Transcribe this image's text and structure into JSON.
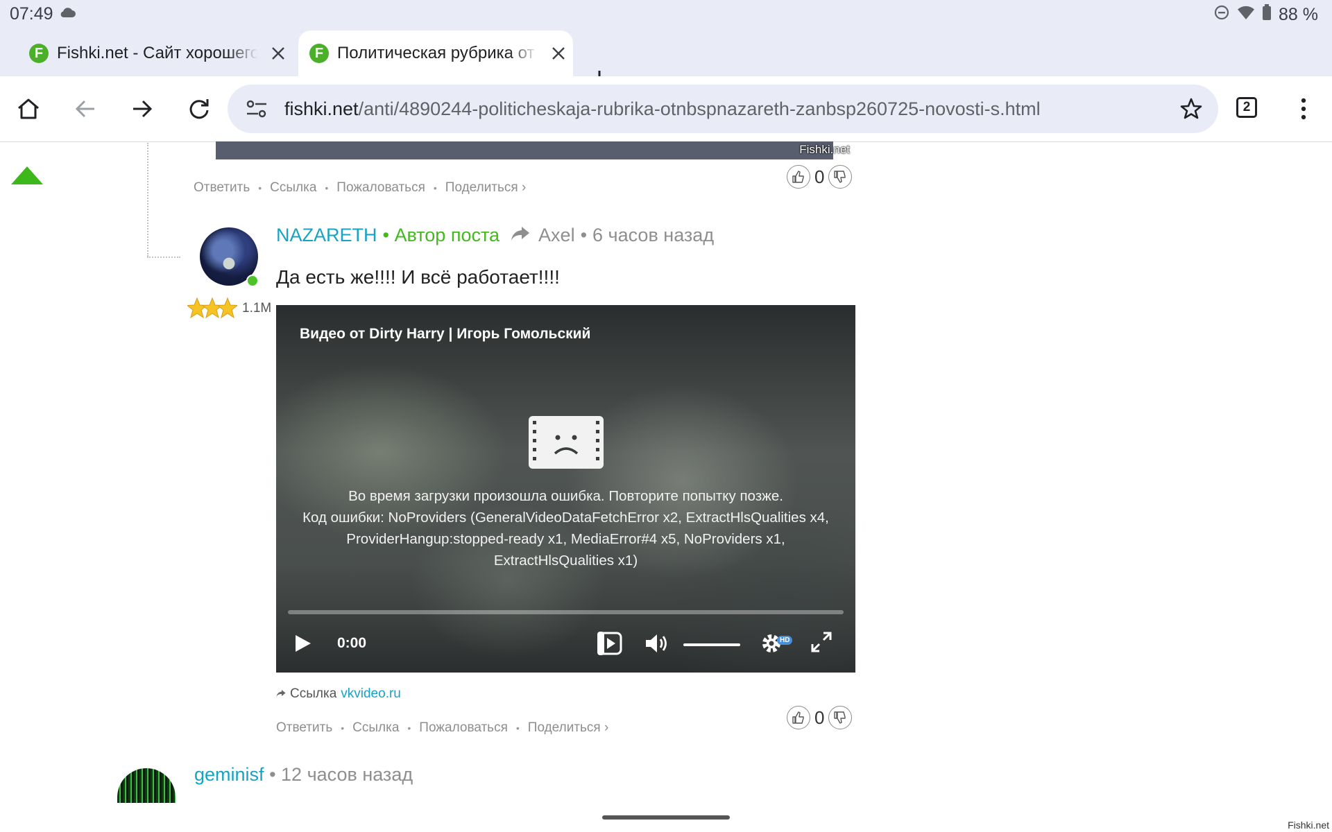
{
  "status_bar": {
    "time": "07:49",
    "battery": "88 %"
  },
  "tabs": [
    {
      "title": "Fishki.net - Сайт хорошего настроения",
      "favicon": "F",
      "active": false
    },
    {
      "title": "Политическая рубрика от NAZARETH",
      "favicon": "F",
      "active": true
    }
  ],
  "toolbar": {
    "url_host": "fishki.net",
    "url_path": "/anti/4890244-politicheskaja-rubrika-otnbspnazareth-zanbsp260725-novosti-s.html",
    "tab_count": "2"
  },
  "previous_comment": {
    "watermark": "Fishki.net",
    "actions": [
      "Ответить",
      "Ссылка",
      "Пожаловаться",
      "Поделиться ›"
    ],
    "votes": "0"
  },
  "comment": {
    "author": "NAZARETH",
    "author_badge": "• Автор поста",
    "reply_to": "Axel",
    "separator": "•",
    "time": "6 часов назад",
    "rating": "1.1M",
    "text": "Да есть же!!!! И всё работает!!!!",
    "video": {
      "title": "Видео от Dirty Harry | Игорь Гомольский",
      "error_line1": "Во время загрузки произошла ошибка. Повторите попытку позже.",
      "error_line2": "Код ошибки: NoProviders (GeneralVideoDataFetchError x2, ExtractHlsQualities x4, ProviderHangup:stopped-ready x1, MediaError#4 x5, NoProviders x1, ExtractHlsQualities x1)",
      "time": "0:00",
      "quality_badge": "HD"
    },
    "source_label": "Ссылка",
    "source_domain": "vkvideo.ru",
    "actions": [
      "Ответить",
      "Ссылка",
      "Пожаловаться",
      "Поделиться ›"
    ],
    "votes": "0"
  },
  "next_comment": {
    "author": "geminisf",
    "separator": "•",
    "time": "12 часов назад"
  },
  "corner_watermark": "Fishki.net",
  "colors": {
    "link": "#16a3c4",
    "author_badge": "#44b81f",
    "up_arrow": "#3cb81a",
    "favicon": "#4caf2a"
  }
}
